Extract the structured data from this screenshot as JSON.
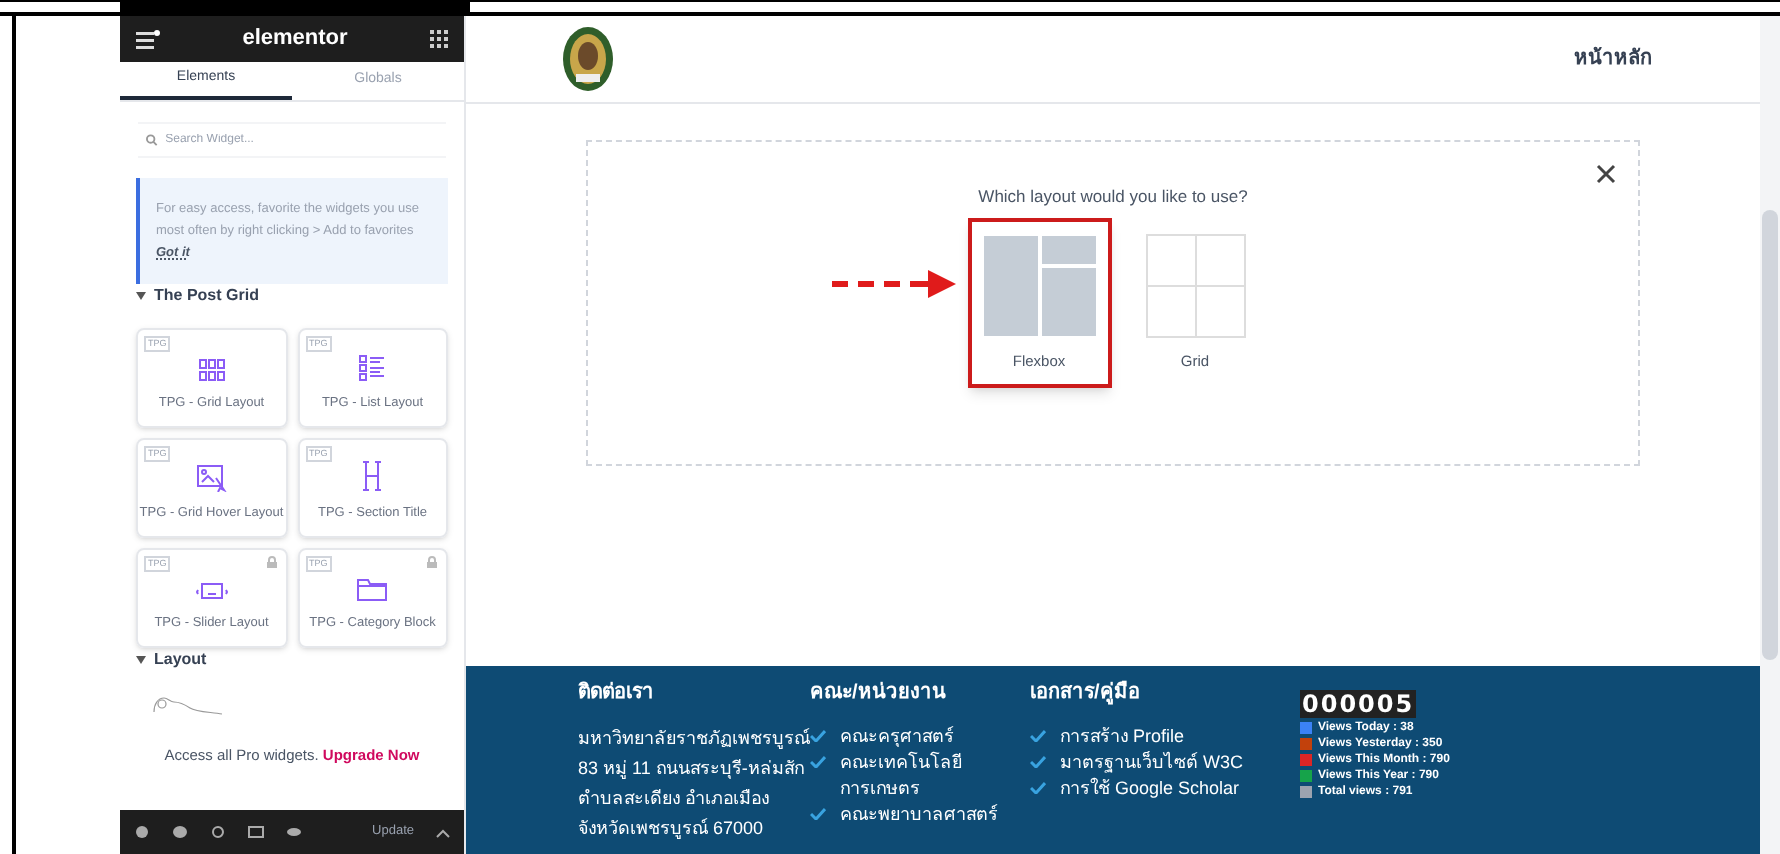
{
  "panel": {
    "app_title": "elementor",
    "tabs": [
      {
        "label": "Elements",
        "selected": true
      },
      {
        "label": "Globals",
        "selected": false
      }
    ],
    "search": {
      "placeholder": "Search Widget..."
    },
    "tip": {
      "text": "For easy access, favorite the widgets you use most often by right clicking > Add to favorites",
      "link": "Got it"
    },
    "sections": [
      {
        "title": "The Post Grid",
        "expanded": true,
        "widgets": [
          {
            "badge": "TPG",
            "label": "TPG - Grid Layout",
            "locked": false
          },
          {
            "badge": "TPG",
            "label": "TPG - List Layout",
            "locked": false
          },
          {
            "badge": "TPG",
            "label": "TPG - Grid Hover Layout",
            "locked": false
          },
          {
            "badge": "TPG",
            "label": "TPG - Section Title",
            "locked": false
          },
          {
            "badge": "TPG",
            "label": "TPG - Slider Layout",
            "locked": true
          },
          {
            "badge": "TPG",
            "label": "TPG - Category Block",
            "locked": true
          }
        ]
      },
      {
        "title": "Layout",
        "expanded": true
      }
    ],
    "promo": {
      "text": "Access all Pro widgets.",
      "link": "Upgrade Now"
    },
    "update_button": "Update"
  },
  "site": {
    "nav": [
      "หน้าหลัก"
    ],
    "layout_picker": {
      "prompt": "Which layout would you like to use?",
      "options": [
        {
          "label": "Flexbox",
          "selected": true
        },
        {
          "label": "Grid",
          "selected": false
        }
      ]
    },
    "footer": {
      "contact": {
        "title": "ติดต่อเรา",
        "lines": [
          "มหาวิทยาลัยราชภัฏเพชรบูรณ์",
          "83 หมู่ 11 ถนนสระบุรี-หล่มสัก",
          "ตำบลสะเดียง อำเภอเมือง",
          "จังหวัดเพชรบูรณ์ 67000"
        ]
      },
      "faculties": {
        "title": "คณะ/หน่วยงาน",
        "items": [
          "คณะครุศาสตร์",
          "คณะเทคโนโลยีการเกษตร",
          "คณะพยาบาลศาสตร์"
        ]
      },
      "documents": {
        "title": "เอกสาร/คู่มือ",
        "items": [
          "การสร้าง Profile",
          "มาตรฐานเว็บไซต์ W3C",
          "การใช้ Google Scholar"
        ]
      },
      "counter": {
        "digits": "000005",
        "stats": [
          "Views Today : 38",
          "Views Yesterday : 350",
          "Views This Month : 790",
          "Views This Year : 790",
          "Total views : 791"
        ]
      }
    }
  }
}
